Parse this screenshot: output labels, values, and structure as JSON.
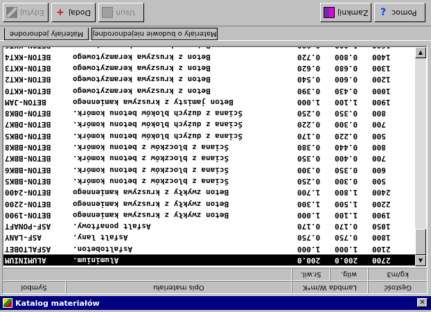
{
  "window": {
    "title": "Katalog materiałów",
    "close_glyph": "✕"
  },
  "toolbar": {
    "edit_label": "Edytuj",
    "add_label": "Dodaj",
    "delete_label": "Usuń",
    "exit_label": "Zamknij",
    "help_label": "Pomoc"
  },
  "tabs": [
    {
      "label": "Materiały jednorodne"
    },
    {
      "label": "Materiały o budowie niejednorodnej"
    }
  ],
  "columns": {
    "symbol": "Symbol",
    "description": "Opis materiału",
    "lambda": "Lambda W/m*K",
    "spec_heat_1": "Sr.wil.",
    "spec_heat_2": "wilg.",
    "density": "Gęstość",
    "density_unit": "kg/m3"
  },
  "rows": [
    {
      "symbol": "ALUMINIUM",
      "description": "Aluminium.",
      "lambda": "200.0",
      "mu": "200.0",
      "rho": "2700",
      "selected": true
    },
    {
      "symbol": "ASFALTOBET",
      "description": "Asfaltobeton.",
      "lambda": "1.000",
      "mu": "1.000",
      "rho": "2100",
      "selected": false
    },
    {
      "symbol": "ASF-LANY",
      "description": "Asfalt lany.",
      "lambda": "0.750",
      "mu": "0.750",
      "rho": "1800",
      "selected": false
    },
    {
      "symbol": "ASF-PONAFT",
      "description": "Asfalt ponaftowy.",
      "lambda": "0.170",
      "mu": "0.170",
      "rho": "1050",
      "selected": false
    },
    {
      "symbol": "BETON-1900",
      "description": "Beton zwykły z kruszywa kamiennego",
      "lambda": "1.000",
      "mu": "1.100",
      "rho": "1900",
      "selected": false
    },
    {
      "symbol": "BETON-2200",
      "description": "Beton zwykły z kruszywa kamiennego",
      "lambda": "1.300",
      "mu": "1.500",
      "rho": "2200",
      "selected": false
    },
    {
      "symbol": "BETON-2400",
      "description": "Beton zwykły z kruszywa kamiennego",
      "lambda": "1.700",
      "mu": "1.800",
      "rho": "2400",
      "selected": false
    },
    {
      "symbol": "BETON-BBK5",
      "description": "Ściana z bloczków z betonu komórk.",
      "lambda": "0.250",
      "mu": "0.300",
      "rho": "500",
      "selected": false
    },
    {
      "symbol": "BETON-BBK6",
      "description": "Ściana z bloczków z betonu komórk.",
      "lambda": "0.300",
      "mu": "0.350",
      "rho": "600",
      "selected": false
    },
    {
      "symbol": "BETON-BBK7",
      "description": "Ściana z bloczków z betonu komórk.",
      "lambda": "0.350",
      "mu": "0.400",
      "rho": "700",
      "selected": false
    },
    {
      "symbol": "BETON-BBK8",
      "description": "Ściana z bloczków z betonu komórk.",
      "lambda": "0.380",
      "mu": "0.440",
      "rho": "800",
      "selected": false
    },
    {
      "symbol": "BETON-DBK5",
      "description": "Ściana z dużych bloków betonu komórk.",
      "lambda": "0.170",
      "mu": "0.220",
      "rho": "500",
      "selected": false
    },
    {
      "symbol": "BETON-DBK7",
      "description": "Ściana z dużych bloków betonu komórk.",
      "lambda": "0.220",
      "mu": "0.300",
      "rho": "700",
      "selected": false
    },
    {
      "symbol": "BETON-DBK8",
      "description": "Ściana z dużych bloków betonu komórk.",
      "lambda": "0.250",
      "mu": "0.350",
      "rho": "800",
      "selected": false
    },
    {
      "symbol": "BETON-JAM",
      "description": "Beton jamisty z kruszywa kamiennego",
      "lambda": "1.000",
      "mu": "1.100",
      "rho": "1900",
      "selected": false
    },
    {
      "symbol": "BETON-KKT0",
      "description": "Beton z kruszywa keramzytowego",
      "lambda": "0.390",
      "mu": "0.430",
      "rho": "1000",
      "selected": false
    },
    {
      "symbol": "BETON-KKT2",
      "description": "Beton z kruszywa keramzytowego",
      "lambda": "0.540",
      "mu": "0.600",
      "rho": "1200",
      "selected": false
    },
    {
      "symbol": "BETON-KKT3",
      "description": "Beton z kruszywa keramzytowego",
      "lambda": "0.620",
      "mu": "0.680",
      "rho": "1300",
      "selected": false
    },
    {
      "symbol": "BETON-KKT4",
      "description": "Beton z kruszywa keramzytowego",
      "lambda": "0.720",
      "mu": "0.800",
      "rho": "1400",
      "selected": false
    },
    {
      "symbol": "BETON-KKT6",
      "description": "Beton z kruszywa keramzytowego",
      "lambda": "0.900",
      "mu": "1.000",
      "rho": "1600",
      "selected": false
    }
  ],
  "scrollbar": {
    "up_glyph": "▲",
    "down_glyph": "▼"
  }
}
